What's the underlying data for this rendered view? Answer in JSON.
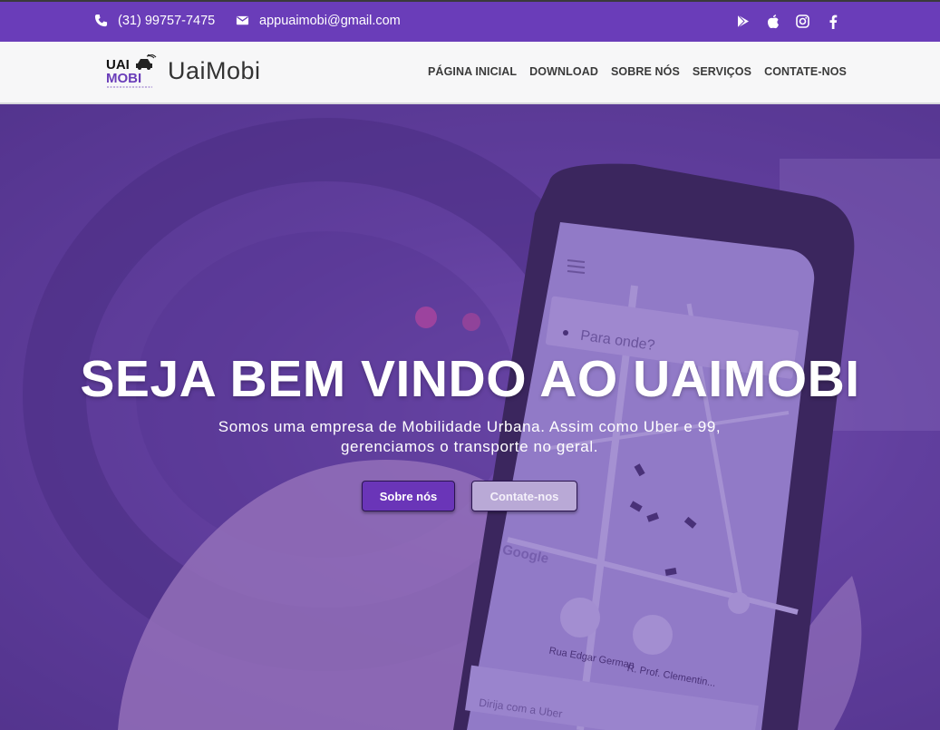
{
  "topbar": {
    "phone": "(31) 99757-7475",
    "email": "appuaimobi@gmail.com",
    "socials": [
      "google-play-icon",
      "apple-icon",
      "instagram-icon",
      "facebook-icon"
    ]
  },
  "navbar": {
    "logo_top": "UAI",
    "logo_bottom": "MOBI",
    "brand": "UaiMobi",
    "links": [
      "PÁGINA INICIAL",
      "DOWNLOAD",
      "SOBRE NÓS",
      "SERVIÇOS",
      "CONTATE-NOS"
    ]
  },
  "hero": {
    "title": "SEJA BEM VINDO AO UAIMOBI",
    "subtitle_line1": "Somos uma empresa de Mobilidade Urbana. Assim como Uber e 99,",
    "subtitle_line2": "gerenciamos o transporte no geral.",
    "primary_button": "Sobre nós",
    "secondary_button": "Contate-nos",
    "phone_search_placeholder": "Para onde?",
    "phone_map_label": "Google",
    "phone_street_1": "Rua Edgar German",
    "phone_street_2": "R. Prof. Clementin...",
    "phone_bottom_text": "Dirija com a Uber"
  },
  "colors": {
    "accent": "#6a3db9",
    "hero_tint": "#6740aa",
    "primary_button": "#6a35b8",
    "secondary_button": "#b9a9d6"
  }
}
